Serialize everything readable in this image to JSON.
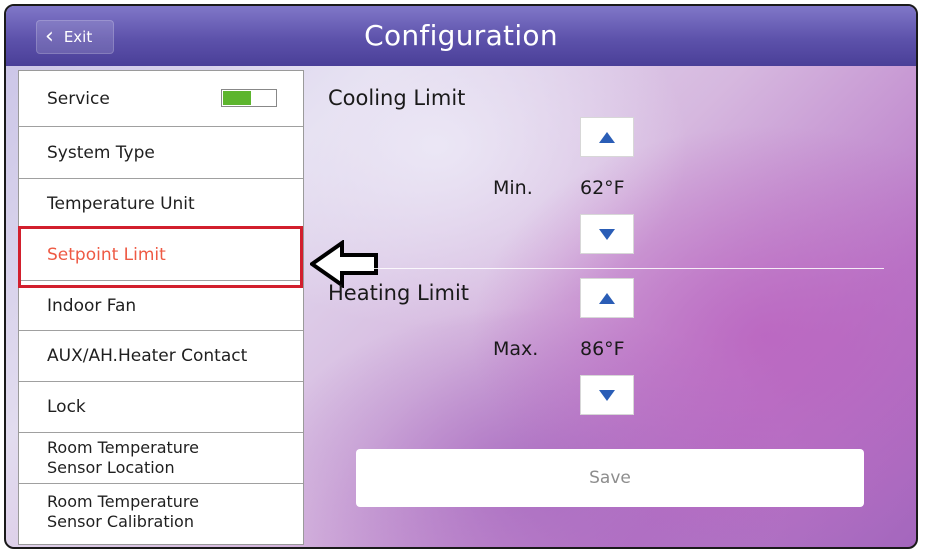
{
  "header": {
    "exit_label": "Exit",
    "title": "Configuration"
  },
  "menu": {
    "items": [
      {
        "label": "Service",
        "toggle_on": true
      },
      {
        "label": "System Type"
      },
      {
        "label": "Temperature Unit"
      },
      {
        "label": "Setpoint Limit",
        "selected": true
      },
      {
        "label": "Indoor Fan"
      },
      {
        "label": "AUX/AH.Heater Contact"
      },
      {
        "label": "Lock"
      },
      {
        "label": "Room Temperature Sensor Location",
        "line1": "Room Temperature",
        "line2": "Sensor Location"
      },
      {
        "label": "Room Temperature Sensor Calibration",
        "line1": "Room Temperature",
        "line2": "Sensor Calibration"
      }
    ]
  },
  "cooling": {
    "label": "Cooling Limit",
    "value_label": "Min.",
    "value": "62°F"
  },
  "heating": {
    "label": "Heating Limit",
    "value_label": "Max.",
    "value": "86°F"
  },
  "save_label": "Save",
  "colors": {
    "titlebar": "#5d52ab",
    "selected_text": "#ee5a44",
    "highlight_border": "#d21f2d",
    "toggle_on": "#5db52e",
    "arrow_icon": "#2a5db6"
  },
  "icons": {
    "exit": "chevron-left-icon",
    "step_up": "triangle-up-icon",
    "step_down": "triangle-down-icon",
    "pointer": "arrow-left-icon"
  }
}
